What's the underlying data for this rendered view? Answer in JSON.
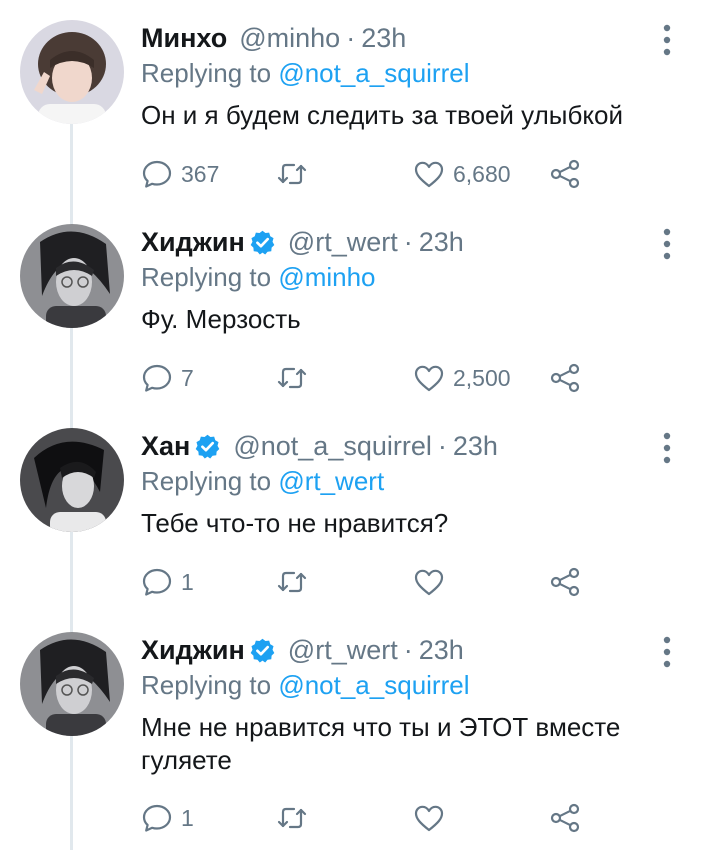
{
  "tweets": [
    {
      "name": "Минхо",
      "verified": false,
      "handle": "@minho",
      "time": "23h",
      "replying_prefix": "Replying to",
      "replying_to": "@not_a_squirrel",
      "text": "Он и я будем следить за твоей улыбкой",
      "replies": "367",
      "retweets": "",
      "likes": "6,680"
    },
    {
      "name": "Хиджин",
      "verified": true,
      "handle": "@rt_wert",
      "time": "23h",
      "replying_prefix": "Replying to",
      "replying_to": "@minho",
      "text": "Фу. Мерзость",
      "replies": "7",
      "retweets": "",
      "likes": "2,500"
    },
    {
      "name": "Хан",
      "verified": true,
      "handle": "@not_a_squirrel",
      "time": "23h",
      "replying_prefix": "Replying to",
      "replying_to": "@rt_wert",
      "text": "Тебе что-то не нравится?",
      "replies": "1",
      "retweets": "",
      "likes": ""
    },
    {
      "name": "Хиджин",
      "verified": true,
      "handle": "@rt_wert",
      "time": "23h",
      "replying_prefix": "Replying to",
      "replying_to": "@not_a_squirrel",
      "text": "Мне не нравится что ты и ЭТОТ вместе гуляете",
      "replies": "1",
      "retweets": "",
      "likes": ""
    }
  ],
  "separator": "·",
  "colors": {
    "accent": "#1da1f2",
    "muted": "#657786",
    "text": "#14171a",
    "thread_line": "#e1e8ed"
  },
  "icons": [
    "reply-icon",
    "retweet-icon",
    "like-icon",
    "share-icon",
    "more-icon",
    "verified-badge-icon"
  ]
}
